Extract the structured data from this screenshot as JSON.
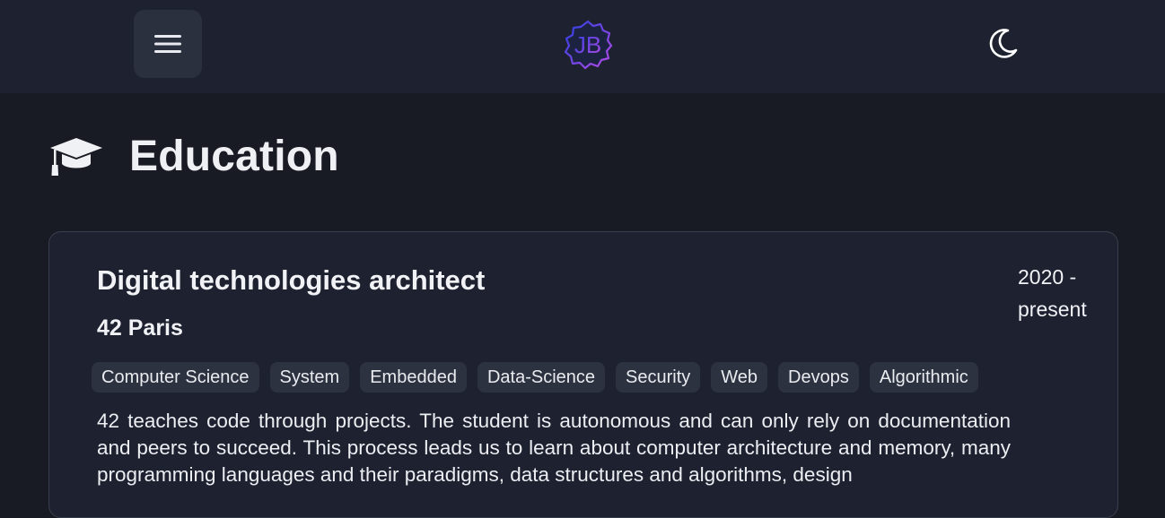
{
  "header": {
    "menu_icon": "hamburger-icon",
    "logo_text": "JB",
    "theme_icon": "moon-icon",
    "colors": {
      "logo_gradient_start": "#2a3fe0",
      "logo_gradient_end": "#b64be8"
    }
  },
  "section": {
    "icon": "graduation-cap-icon",
    "title": "Education"
  },
  "education": [
    {
      "degree": "Digital technologies architect",
      "school": "42 Paris",
      "dates_start": "2020 -",
      "dates_end": "present",
      "tags": [
        "Computer Science",
        "System",
        "Embedded",
        "Data-Science",
        "Security",
        "Web",
        "Devops",
        "Algorithmic"
      ],
      "description": "42 teaches code through projects. The student is autonomous and can only rely on documentation and peers to succeed. This process leads us to learn about computer architecture and memory, many programming languages and their paradigms, data structures and algorithms, design"
    }
  ]
}
